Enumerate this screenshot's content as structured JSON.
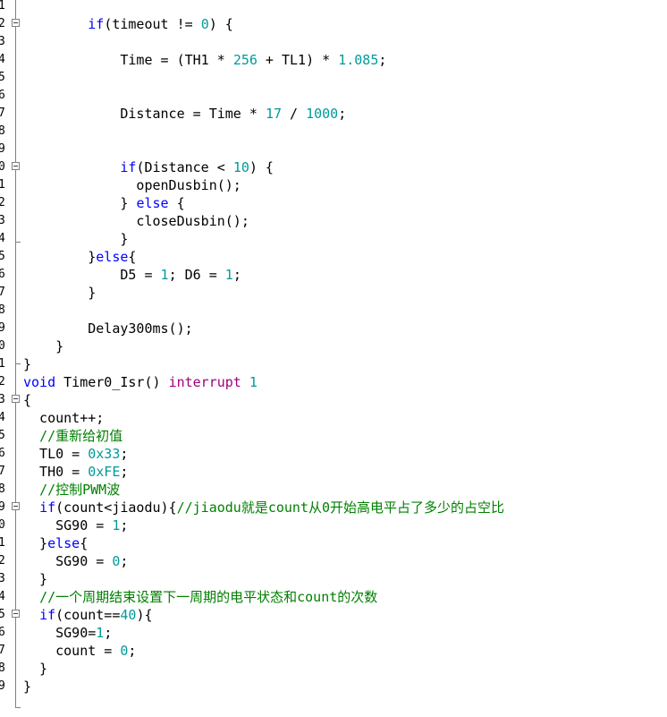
{
  "gutter": {
    "line_numbers": [
      "1",
      "2",
      "3",
      "4",
      "5",
      "6",
      "7",
      "8",
      "9",
      "0",
      "1",
      "2",
      "3",
      "4",
      "5",
      "6",
      "7",
      "8",
      "9",
      "0",
      "1",
      "2",
      "3",
      "4",
      "5",
      "6",
      "7",
      "8",
      "9",
      "0",
      "1",
      "2",
      "3",
      "4",
      "5",
      "6",
      "7",
      "8",
      "9"
    ]
  },
  "code": {
    "lines": [
      [],
      [
        {
          "t": "        "
        },
        {
          "t": "if",
          "c": "kw"
        },
        {
          "t": "(timeout != "
        },
        {
          "t": "0",
          "c": "num"
        },
        {
          "t": ") {"
        }
      ],
      [],
      [
        {
          "t": "            Time = (TH1 * "
        },
        {
          "t": "256",
          "c": "num"
        },
        {
          "t": " + TL1) * "
        },
        {
          "t": "1.085",
          "c": "num"
        },
        {
          "t": ";"
        }
      ],
      [],
      [],
      [
        {
          "t": "            Distance = Time * "
        },
        {
          "t": "17",
          "c": "num"
        },
        {
          "t": " / "
        },
        {
          "t": "1000",
          "c": "num"
        },
        {
          "t": ";"
        }
      ],
      [],
      [],
      [
        {
          "t": "            "
        },
        {
          "t": "if",
          "c": "kw"
        },
        {
          "t": "(Distance < "
        },
        {
          "t": "10",
          "c": "num"
        },
        {
          "t": ") {"
        }
      ],
      [
        {
          "t": "              openDusbin();"
        }
      ],
      [
        {
          "t": "            } "
        },
        {
          "t": "else",
          "c": "kw"
        },
        {
          "t": " {"
        }
      ],
      [
        {
          "t": "              closeDusbin();"
        }
      ],
      [
        {
          "t": "            }"
        }
      ],
      [
        {
          "t": "        }"
        },
        {
          "t": "else",
          "c": "kw"
        },
        {
          "t": "{"
        }
      ],
      [
        {
          "t": "            D5 = "
        },
        {
          "t": "1",
          "c": "num"
        },
        {
          "t": "; D6 = "
        },
        {
          "t": "1",
          "c": "num"
        },
        {
          "t": ";"
        }
      ],
      [
        {
          "t": "        }"
        }
      ],
      [],
      [
        {
          "t": "        Delay300ms();"
        }
      ],
      [
        {
          "t": "    }"
        }
      ],
      [
        {
          "t": "}"
        }
      ],
      [
        {
          "t": "void",
          "c": "kw"
        },
        {
          "t": " Timer0_Isr() "
        },
        {
          "t": "interrupt",
          "c": "kw2"
        },
        {
          "t": " "
        },
        {
          "t": "1",
          "c": "num"
        }
      ],
      [
        {
          "t": "{"
        }
      ],
      [
        {
          "t": "  count++;"
        }
      ],
      [
        {
          "t": "  "
        },
        {
          "t": "//重新给初值",
          "c": "cmt"
        }
      ],
      [
        {
          "t": "  TL0 = "
        },
        {
          "t": "0x33",
          "c": "num"
        },
        {
          "t": ";"
        }
      ],
      [
        {
          "t": "  TH0 = "
        },
        {
          "t": "0xFE",
          "c": "num"
        },
        {
          "t": ";"
        }
      ],
      [
        {
          "t": "  "
        },
        {
          "t": "//控制PWM波",
          "c": "cmt"
        }
      ],
      [
        {
          "t": "  "
        },
        {
          "t": "if",
          "c": "kw"
        },
        {
          "t": "(count<jiaodu){"
        },
        {
          "t": "//jiaodu就是count从0开始高电平占了多少的占空比",
          "c": "cmt"
        }
      ],
      [
        {
          "t": "    SG90 = "
        },
        {
          "t": "1",
          "c": "num"
        },
        {
          "t": ";"
        }
      ],
      [
        {
          "t": "  }"
        },
        {
          "t": "else",
          "c": "kw"
        },
        {
          "t": "{"
        }
      ],
      [
        {
          "t": "    SG90 = "
        },
        {
          "t": "0",
          "c": "num"
        },
        {
          "t": ";"
        }
      ],
      [
        {
          "t": "  }"
        }
      ],
      [
        {
          "t": "  "
        },
        {
          "t": "//一个周期结束设置下一周期的电平状态和count的次数",
          "c": "cmt"
        }
      ],
      [
        {
          "t": "  "
        },
        {
          "t": "if",
          "c": "kw"
        },
        {
          "t": "(count=="
        },
        {
          "t": "40",
          "c": "num"
        },
        {
          "t": "){"
        }
      ],
      [
        {
          "t": "    SG90="
        },
        {
          "t": "1",
          "c": "num"
        },
        {
          "t": ";"
        }
      ],
      [
        {
          "t": "    count = "
        },
        {
          "t": "0",
          "c": "num"
        },
        {
          "t": ";"
        }
      ],
      [
        {
          "t": "  }"
        }
      ],
      [
        {
          "t": "}"
        }
      ]
    ]
  },
  "colors": {
    "keyword": "#0000ff",
    "number": "#009a9a",
    "comment": "#008000",
    "keyword_special": "#a0007a"
  }
}
